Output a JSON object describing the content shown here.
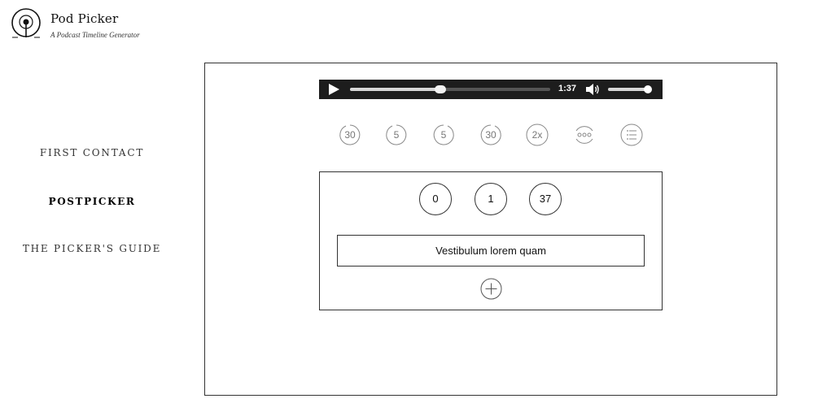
{
  "brand": {
    "title": "Pod Picker",
    "subtitle": "A Podcast Timeline Generator",
    "logo_icon": "podcast-broadcast-icon"
  },
  "nav": {
    "items": [
      {
        "label": "FIRST CONTACT",
        "active": false
      },
      {
        "label": "POSTPICKER",
        "active": true
      },
      {
        "label": "THE PICKER'S GUIDE",
        "active": false
      }
    ]
  },
  "player": {
    "play_icon": "play-icon",
    "current_time": "1:37",
    "progress": 0.45,
    "volume_icon": "volume-icon",
    "volume": 0.95,
    "background_color": "#1d1d1d"
  },
  "controls": [
    {
      "label": "30",
      "icon": "rewind-30-icon"
    },
    {
      "label": "5",
      "icon": "rewind-5-icon"
    },
    {
      "label": "5",
      "icon": "forward-5-icon"
    },
    {
      "label": "30",
      "icon": "forward-30-icon"
    },
    {
      "label": "2x",
      "icon": "speed-icon"
    },
    {
      "label": "",
      "icon": "more-icon"
    },
    {
      "label": "",
      "icon": "list-icon"
    }
  ],
  "timestamp": {
    "hours": "0",
    "minutes": "1",
    "seconds": "37"
  },
  "entry": {
    "text": "Vestibulum lorem quam",
    "add_icon": "plus-icon"
  }
}
